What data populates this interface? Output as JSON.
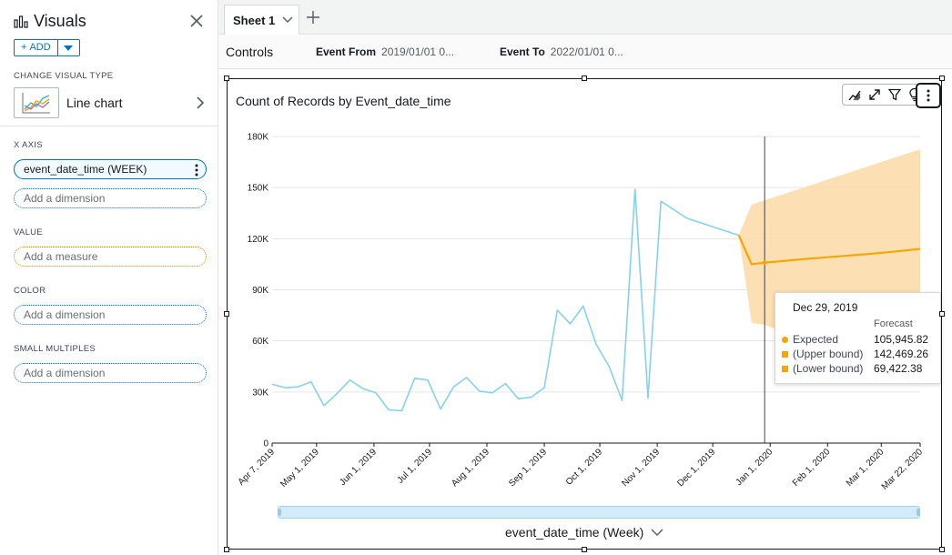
{
  "left_panel": {
    "title": "Visuals",
    "add_button": "ADD",
    "change_visual_type_label": "CHANGE VISUAL TYPE",
    "visual_type": "Line chart",
    "x_axis_label": "X AXIS",
    "x_axis_field": "event_date_time (WEEK)",
    "x_axis_add": "Add a dimension",
    "value_label": "VALUE",
    "value_add": "Add a measure",
    "color_label": "COLOR",
    "color_add": "Add a dimension",
    "small_multiples_label": "SMALL MULTIPLES",
    "small_multiples_add": "Add a dimension"
  },
  "sheet_bar": {
    "tab": "Sheet 1"
  },
  "controls": {
    "title": "Controls",
    "event_from_label": "Event From",
    "event_from_value": "2019/01/01 0...",
    "event_to_label": "Event To",
    "event_to_value": "2022/01/01 0..."
  },
  "visual": {
    "x_field_label": "event_date_time (Week)",
    "toolbar_icons": [
      "forecast-icon",
      "expand-icon",
      "filter-icon",
      "insight-icon",
      "more-options-icon"
    ]
  },
  "colors": {
    "actual": "#86d2e8",
    "forecast": "#f5a700",
    "band": "#fcd9a5",
    "accent": "#0073bb"
  },
  "tooltip": {
    "date": "Dec 29, 2019",
    "column": "Forecast",
    "rows": [
      {
        "name": "Expected",
        "value": "105,945.82",
        "marker": "circle"
      },
      {
        "name": "(Upper bound)",
        "value": "142,469.26",
        "marker": "square"
      },
      {
        "name": "(Lower bound)",
        "value": "69,422.38",
        "marker": "square"
      }
    ]
  },
  "chart_data": {
    "type": "line",
    "title": "Count of Records by Event_date_time",
    "xlabel": "event_date_time (Week)",
    "ylabel": "",
    "ylim": [
      0,
      180000
    ],
    "y_ticks": [
      0,
      30000,
      60000,
      90000,
      120000,
      150000,
      180000
    ],
    "y_tick_labels": [
      "0",
      "30K",
      "60K",
      "90K",
      "120K",
      "150K",
      "180K"
    ],
    "x_tick_labels": [
      "Apr 7, 2019",
      "May 1, 2019",
      "Jun 1, 2019",
      "Jul 1, 2019",
      "Aug 1, 2019",
      "Sep 1, 2019",
      "Oct 1, 2019",
      "Nov 1, 2019",
      "Dec 1, 2019",
      "Jan 1, 2020",
      "Feb 1, 2020",
      "Mar 1, 2020",
      "Mar 22, 2020"
    ],
    "x_tick_dates": [
      "2019-04-07",
      "2019-05-01",
      "2019-06-01",
      "2019-07-01",
      "2019-08-01",
      "2019-09-01",
      "2019-10-01",
      "2019-11-01",
      "2019-12-01",
      "2020-01-01",
      "2020-02-01",
      "2020-03-01",
      "2020-03-22"
    ],
    "grid": true,
    "hover_date": "2019-12-29",
    "series": [
      {
        "name": "Count of Records",
        "x": [
          "2019-04-07",
          "2019-04-14",
          "2019-04-21",
          "2019-04-28",
          "2019-05-05",
          "2019-05-12",
          "2019-05-19",
          "2019-05-26",
          "2019-06-02",
          "2019-06-09",
          "2019-06-16",
          "2019-06-23",
          "2019-06-30",
          "2019-07-07",
          "2019-07-14",
          "2019-07-21",
          "2019-07-28",
          "2019-08-04",
          "2019-08-11",
          "2019-08-18",
          "2019-08-25",
          "2019-09-01",
          "2019-09-08",
          "2019-09-15",
          "2019-09-22",
          "2019-09-29",
          "2019-10-06",
          "2019-10-13",
          "2019-10-20",
          "2019-10-27",
          "2019-11-03",
          "2019-11-17",
          "2019-12-15"
        ],
        "values": [
          34500,
          32500,
          33000,
          36000,
          22000,
          29000,
          37000,
          32000,
          29500,
          19500,
          19000,
          38000,
          37000,
          20000,
          33000,
          38500,
          30500,
          29500,
          35000,
          26000,
          27000,
          32500,
          78000,
          70000,
          80500,
          58000,
          45000,
          25000,
          149000,
          26500,
          142000,
          132000,
          122000
        ]
      },
      {
        "name": "Forecast",
        "x": [
          "2019-12-15",
          "2019-12-22",
          "2019-12-29",
          "2020-01-05",
          "2020-01-12",
          "2020-01-19",
          "2020-01-26",
          "2020-02-02",
          "2020-02-09",
          "2020-02-16",
          "2020-02-23",
          "2020-03-01",
          "2020-03-08",
          "2020-03-15",
          "2020-03-22"
        ],
        "values": [
          122000,
          105000,
          105946,
          106600,
          107300,
          108000,
          108600,
          109200,
          109800,
          110400,
          111000,
          111700,
          112400,
          113200,
          114000
        ],
        "upper": [
          122000,
          140000,
          142469,
          145000,
          147500,
          150000,
          152500,
          155000,
          157500,
          160000,
          162500,
          165000,
          167500,
          170000,
          172500
        ],
        "lower": [
          122000,
          70500,
          69422,
          66500,
          64000,
          61000,
          58500,
          56000,
          53500,
          51000,
          48500,
          46000,
          43500,
          41000,
          38500
        ]
      }
    ]
  }
}
